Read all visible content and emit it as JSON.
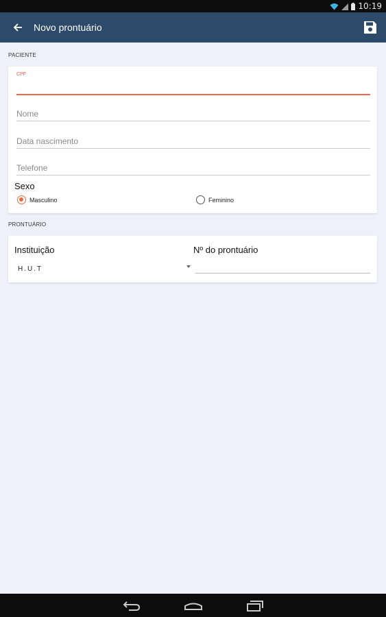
{
  "status_bar": {
    "time": "10:19"
  },
  "app_bar": {
    "title": "Novo prontuário"
  },
  "paciente": {
    "section_label": "PACIENTE",
    "cpf_label": "CPF",
    "nome_placeholder": "Nome",
    "nascimento_placeholder": "Data nascimento",
    "telefone_placeholder": "Telefone",
    "sexo_label": "Sexo",
    "sexo_options": [
      "Masculino",
      "Feminino"
    ],
    "sexo_selected": "Masculino"
  },
  "prontuario": {
    "section_label": "PRONTUÁRIO",
    "instituicao_label": "Instituição",
    "instituicao_value": "H.U.T",
    "numero_label": "Nº do prontuário"
  },
  "colors": {
    "app_bar": "#2e4a6a",
    "accent": "#ec6a4a",
    "background": "#eef0fa"
  }
}
